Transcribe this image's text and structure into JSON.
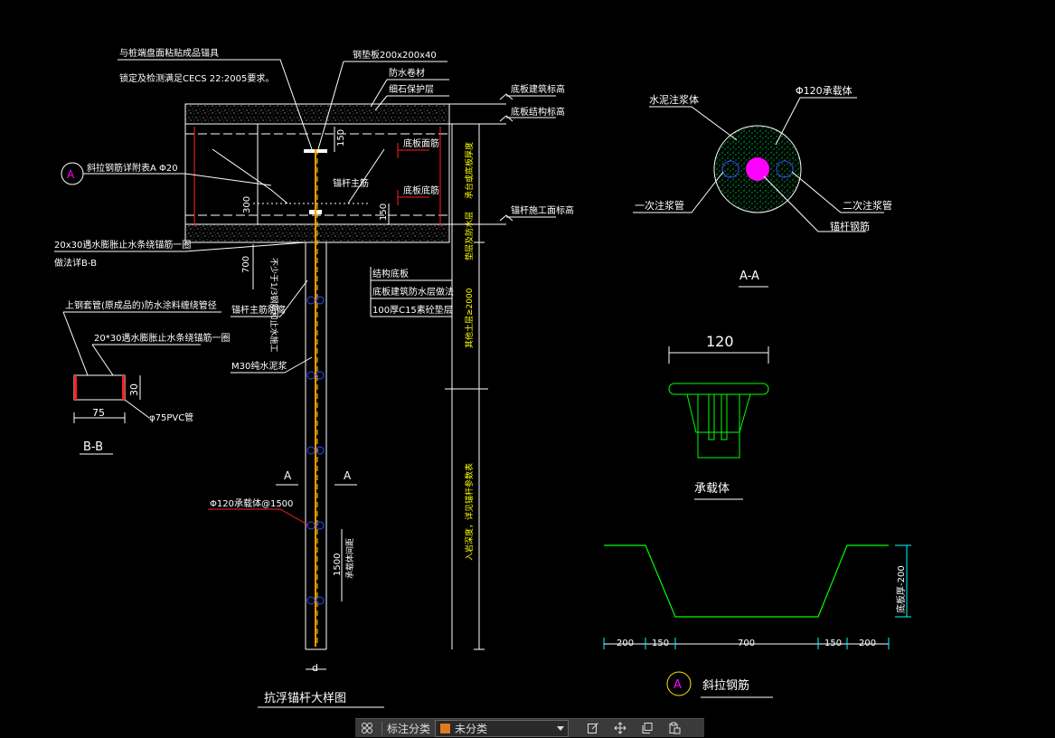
{
  "colors": {
    "background": "#000000",
    "line_white": "#ffffff",
    "line_cyan": "#00ffff",
    "line_red": "#ff2020",
    "line_green": "#00ff00",
    "line_yellow": "#ffe000",
    "line_orange": "#ff9900",
    "line_magenta": "#ff00ff",
    "line_blue": "#3050ff",
    "text_white": "#ffffff",
    "text_yellow": "#ffff00",
    "annotation_swatch": "#e07a1e"
  },
  "main_detail": {
    "title": "抗浮锚杆大样图",
    "notes": {
      "n1": "与桩端盘面粘贴成品锚具",
      "n2": "锁定及检测满足CECS 22:2005要求。",
      "steel_plate": "钢垫板200x200x40",
      "waterproof_layer": "防水卷材",
      "protect_layer": "细石保护层",
      "floor_top": "底板建筑标高",
      "floor_structure": "底板结构标高",
      "floor_face": "底板面筋",
      "bottom_bar": "底板底筋",
      "anchor_main": "锚杆主筋",
      "tilt_bar_label": "斜拉钢筋详附表A Φ20",
      "waterproof_pipe": "20x30遇水膨胀止水条绕锚筋一圈",
      "section_ref": "做法详B-B",
      "anchor_top_mark": "锚杆施工面标高",
      "wrap_note": "不少于1/3钢筋和止水施工",
      "anti_rust": "锚杆主筋防腐",
      "grout": "M30纯水泥浆",
      "bearing_note": "Φ120承载体@1500",
      "structure_floor": "结构底板",
      "waterproof_coat": "底板建筑防水层做法",
      "c15": "100厚C15素砼垫层",
      "vert_label_1": "承台或底板厚度",
      "vert_label_2": "垫层及防水层",
      "vert_label_3": "其他土层≥2000",
      "vert_label_4": "入岩深度，详见锚杆参数表",
      "dim_150a": "150",
      "dim_300": "300",
      "dim_150b": "150",
      "dim_700": "700",
      "dim_1500": "1500",
      "dim_1500_note": "承载体间距",
      "dim_d": "d",
      "section_a_left": "A",
      "section_a_right": "A",
      "bubble_a": "A"
    }
  },
  "section_bb": {
    "title": "B-B",
    "note1": "上钢套管(原成品的)防水涂料缠绕管径",
    "note2": "20*30遇水膨胀止水条绕锚筋一圈",
    "dim_75": "75",
    "dim_30": "30",
    "pvc": "φ75PVC管"
  },
  "section_aa": {
    "title": "A-A",
    "grout_label": "水泥注浆体",
    "bearing_label": "Φ120承载体",
    "pipe1": "一次注浆管",
    "pipe2": "二次注浆管",
    "rebar": "锚杆钢筋"
  },
  "bearing_body": {
    "title": "承载体",
    "dim_120": "120"
  },
  "tilt_bar": {
    "bubble": "A",
    "title": "斜拉钢筋",
    "dim_200a": "200",
    "dim_150a": "150",
    "dim_700": "700",
    "dim_150b": "150",
    "dim_200b": "200",
    "dim_vert": "底板厚-200"
  },
  "toolbar": {
    "grid_icon": "grid-icon",
    "label": "标注分类",
    "select_value": "未分类",
    "select_swatch": "#e07a1e",
    "buttons": [
      "edit-icon",
      "move-icon",
      "copy-icon",
      "paste-icon"
    ]
  }
}
